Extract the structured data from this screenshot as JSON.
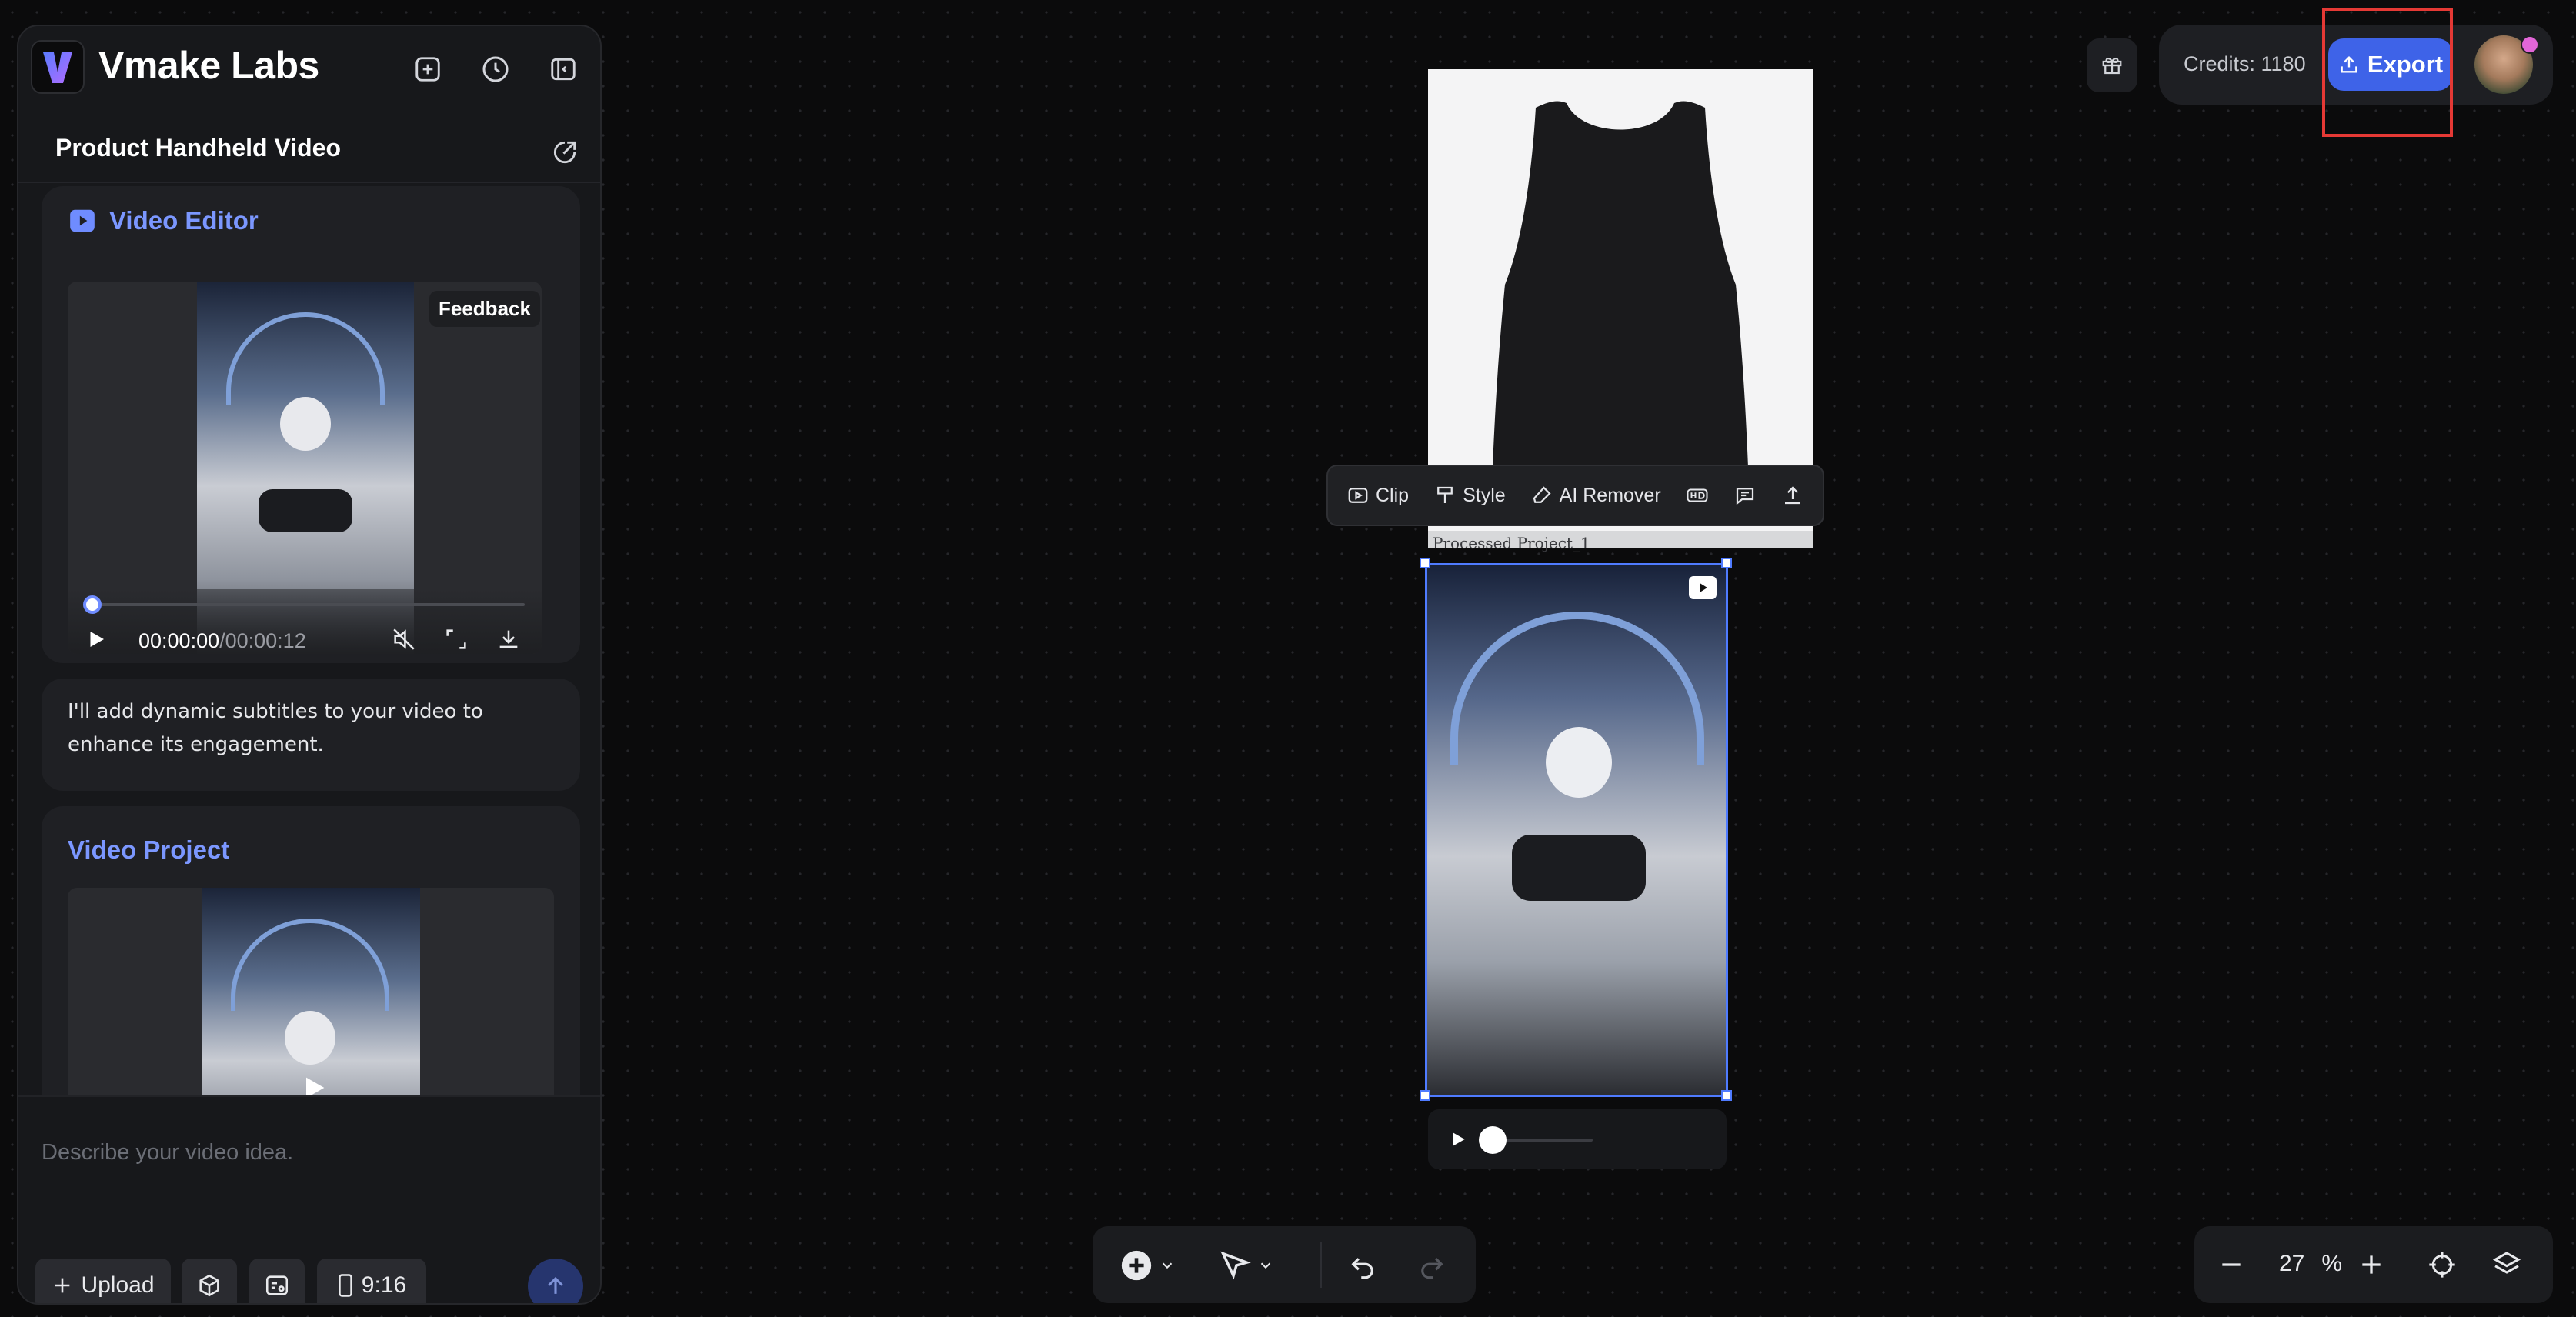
{
  "app": {
    "brand": "Vmake Labs"
  },
  "panel": {
    "project_title": "Product Handheld Video",
    "video_editor": {
      "title": "Video Editor",
      "feedback_label": "Feedback",
      "time_current": "00:00:00",
      "time_total": "/00:00:12",
      "progress": 0
    },
    "message": "I'll add dynamic subtitles to your video to enhance its engagement.",
    "video_project": {
      "title": "Video Project"
    },
    "input": {
      "placeholder": "Describe your video idea.",
      "upload_label": "Upload",
      "aspect_ratio_label": "9:16"
    }
  },
  "canvas": {
    "context_toolbar": {
      "clip_label": "Clip",
      "style_label": "Style",
      "ai_remover_label": "AI Remover"
    },
    "processed_label": "Processed Project_1",
    "video_player": {
      "progress": 0
    }
  },
  "top_right": {
    "credits_label": "Credits: 1180",
    "export_label": "Export"
  },
  "zoom": {
    "value": "27",
    "unit": "%"
  },
  "colors": {
    "accent": "#3e63e8",
    "title_blue": "#7b97ff",
    "highlight": "#e53935"
  }
}
